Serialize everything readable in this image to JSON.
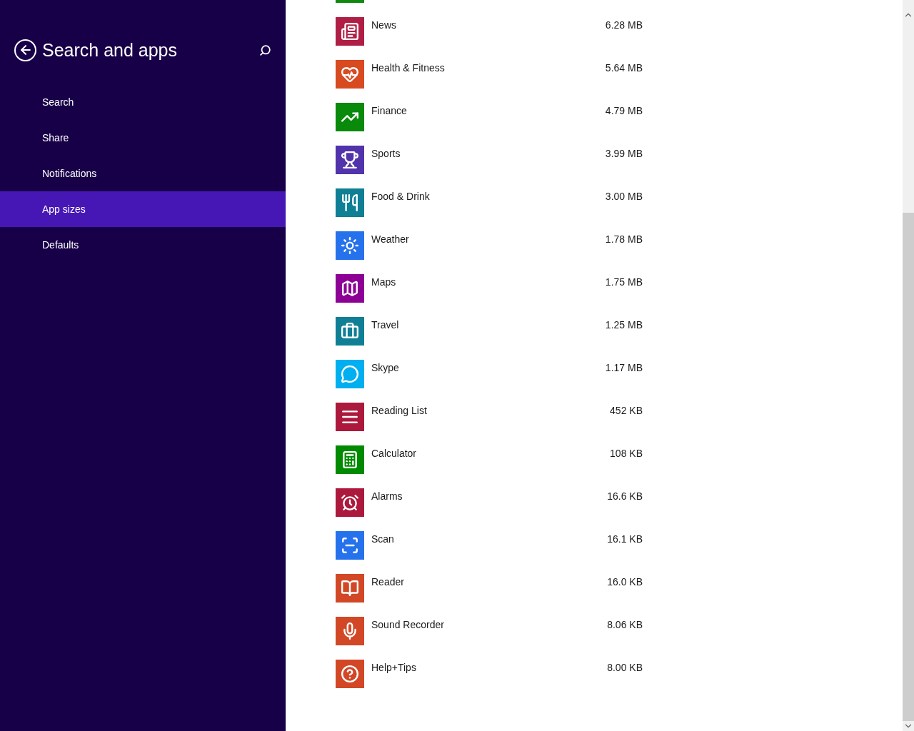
{
  "sidebar": {
    "title": "Search and apps",
    "items": [
      {
        "label": "Search",
        "selected": false
      },
      {
        "label": "Share",
        "selected": false
      },
      {
        "label": "Notifications",
        "selected": false
      },
      {
        "label": "App sizes",
        "selected": true
      },
      {
        "label": "Defaults",
        "selected": false
      }
    ]
  },
  "clipped_tile": {
    "color": "#0f8a0f"
  },
  "apps": [
    {
      "name": "News",
      "size": "6.28 MB",
      "kind": "news",
      "color": "#b01e45"
    },
    {
      "name": "Health & Fitness",
      "size": "5.64 MB",
      "kind": "health",
      "color": "#d84a20"
    },
    {
      "name": "Finance",
      "size": "4.79 MB",
      "kind": "finance",
      "color": "#0a8a0a"
    },
    {
      "name": "Sports",
      "size": "3.99 MB",
      "kind": "sports",
      "color": "#5133ab"
    },
    {
      "name": "Food & Drink",
      "size": "3.00 MB",
      "kind": "food",
      "color": "#0e7f95"
    },
    {
      "name": "Weather",
      "size": "1.78 MB",
      "kind": "weather",
      "color": "#2672ec"
    },
    {
      "name": "Maps",
      "size": "1.75 MB",
      "kind": "maps",
      "color": "#8c0095"
    },
    {
      "name": "Travel",
      "size": "1.25 MB",
      "kind": "travel",
      "color": "#0e7f95"
    },
    {
      "name": "Skype",
      "size": "1.17 MB",
      "kind": "chat",
      "color": "#00aff0"
    },
    {
      "name": "Reading List",
      "size": "452 KB",
      "kind": "list",
      "color": "#ac193d"
    },
    {
      "name": "Calculator",
      "size": "108 KB",
      "kind": "calculator",
      "color": "#008a00"
    },
    {
      "name": "Alarms",
      "size": "16.6 KB",
      "kind": "alarm",
      "color": "#ac193d"
    },
    {
      "name": "Scan",
      "size": "16.1 KB",
      "kind": "scan",
      "color": "#2672ec"
    },
    {
      "name": "Reader",
      "size": "16.0 KB",
      "kind": "reader",
      "color": "#d24726"
    },
    {
      "name": "Sound Recorder",
      "size": "8.06 KB",
      "kind": "mic",
      "color": "#d24726"
    },
    {
      "name": "Help+Tips",
      "size": "8.00 KB",
      "kind": "help",
      "color": "#d24726"
    }
  ]
}
